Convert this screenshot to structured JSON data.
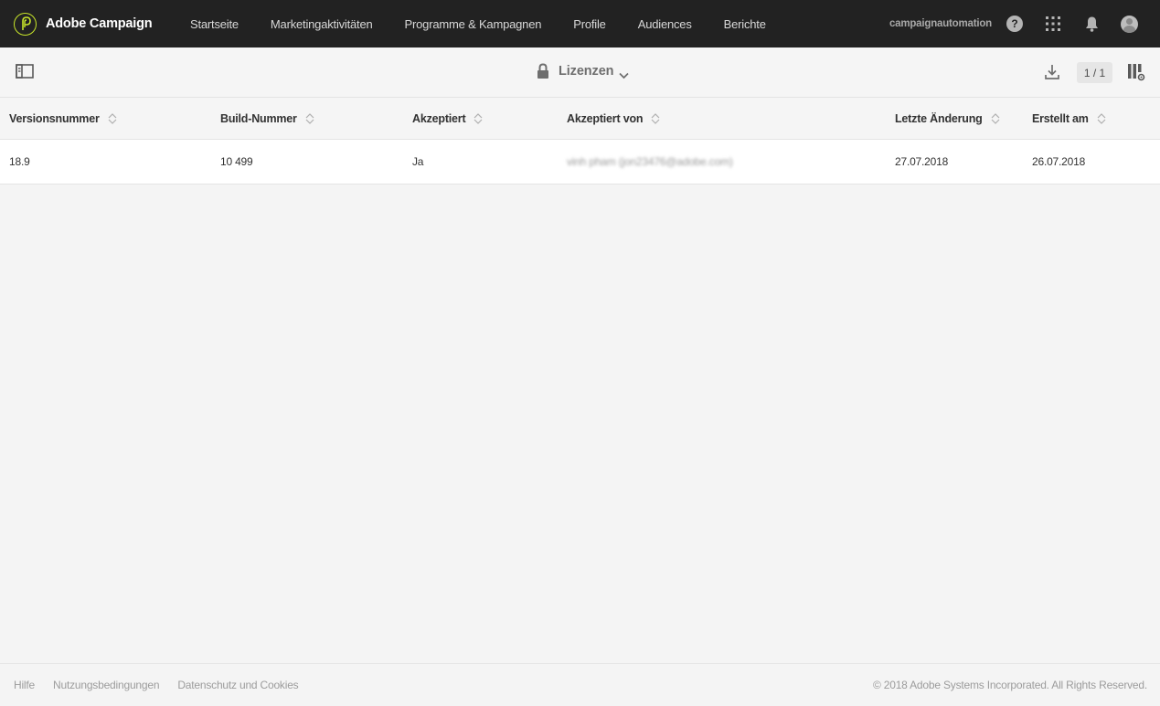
{
  "app": {
    "brand_name": "Adobe Campaign",
    "org_name": "campaignautomation",
    "accent_color": "#c8e62a"
  },
  "nav": {
    "items": [
      {
        "label": "Startseite"
      },
      {
        "label": "Marketingaktivitäten"
      },
      {
        "label": "Programme & Kampagnen"
      },
      {
        "label": "Profile"
      },
      {
        "label": "Audiences"
      },
      {
        "label": "Berichte"
      }
    ]
  },
  "topbar_icons": {
    "help": "?",
    "help_name": "help-icon",
    "apps_name": "apps-grid-icon",
    "bell_name": "bell-icon",
    "avatar_name": "avatar-icon"
  },
  "toolbar": {
    "title": "Lizenzen",
    "pagination": "1 / 1"
  },
  "table": {
    "columns": [
      {
        "label": "Versionsnummer"
      },
      {
        "label": "Build-Nummer"
      },
      {
        "label": "Akzeptiert"
      },
      {
        "label": "Akzeptiert von"
      },
      {
        "label": "Letzte Änderung"
      },
      {
        "label": "Erstellt am"
      }
    ],
    "rows": [
      {
        "version": "18.9",
        "build": "10 499",
        "accepted": "Ja",
        "accepted_by": "vinh pham (jon23476@adobe.com)",
        "last_modified": "27.07.2018",
        "created": "26.07.2018"
      }
    ]
  },
  "footer": {
    "links": [
      {
        "label": "Hilfe"
      },
      {
        "label": "Nutzungsbedingungen"
      },
      {
        "label": "Datenschutz und Cookies"
      }
    ],
    "copyright": "© 2018 Adobe Systems Incorporated. All Rights Reserved."
  }
}
